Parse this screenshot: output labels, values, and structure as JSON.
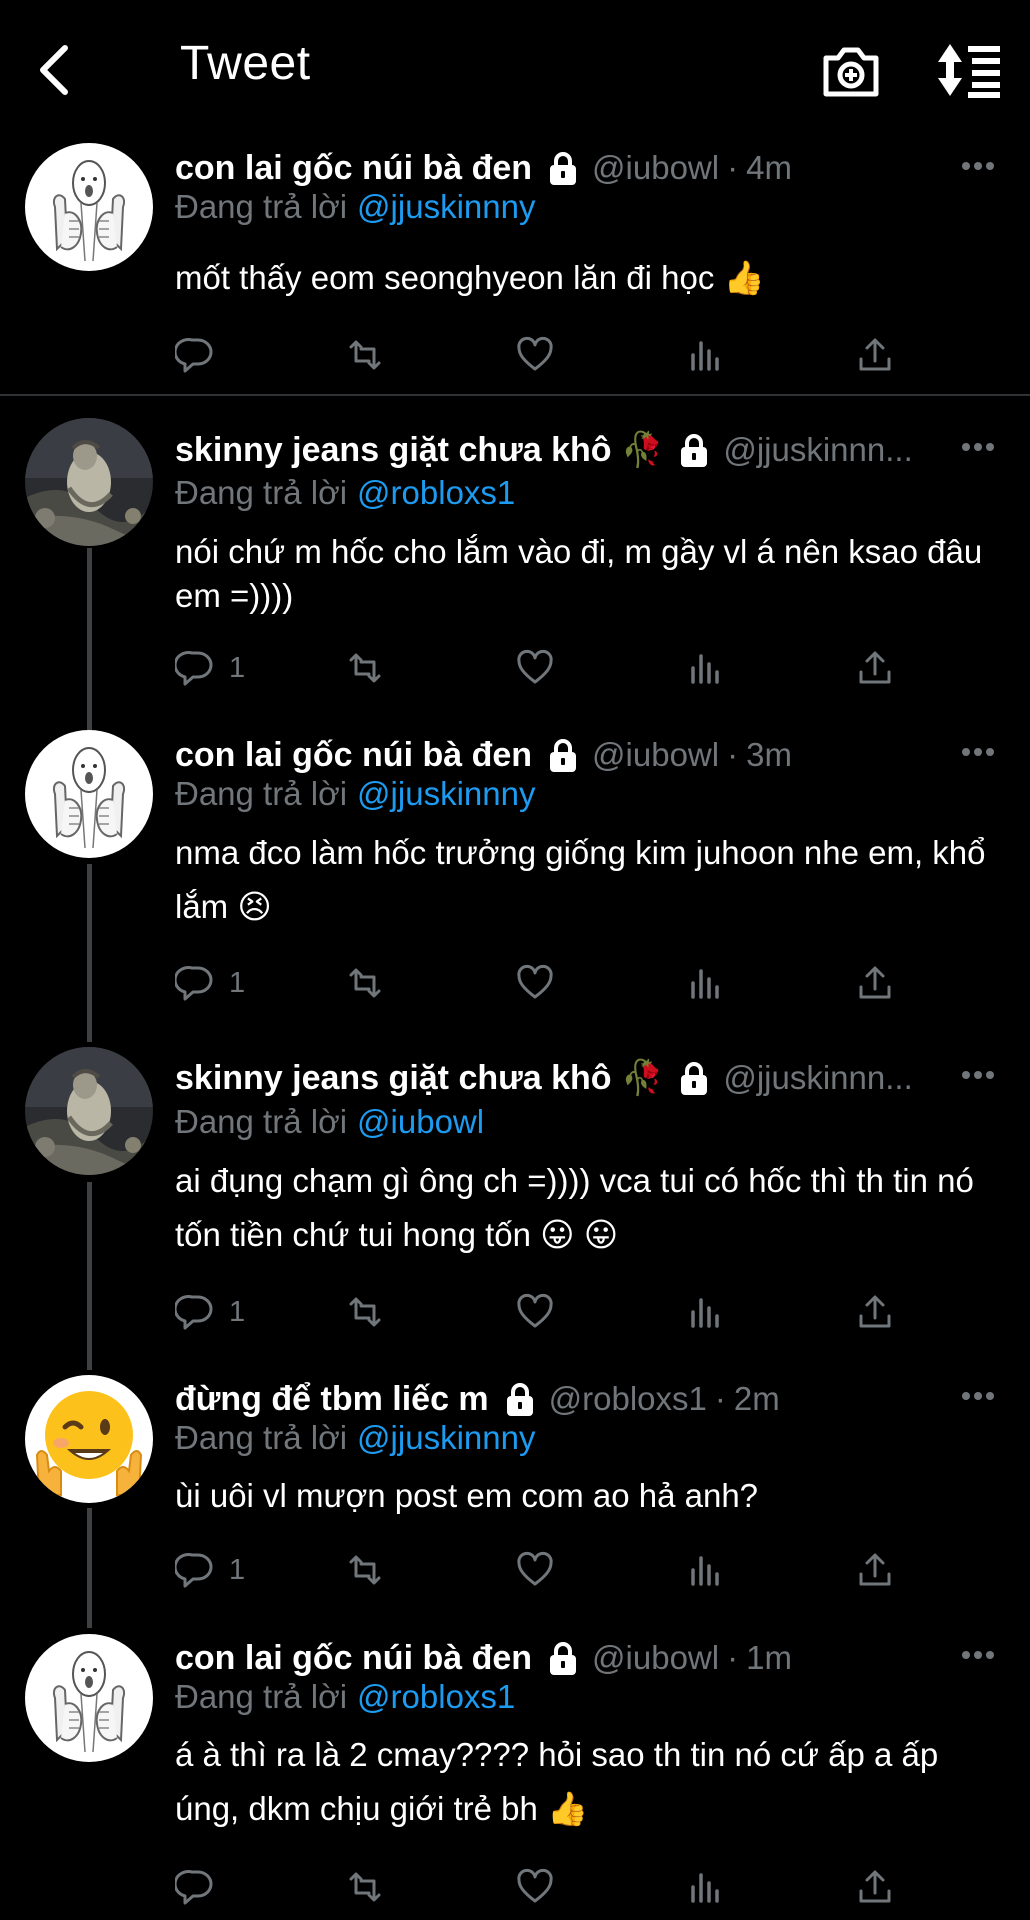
{
  "header": {
    "title": "Tweet",
    "back_icon": "chevron-left-icon",
    "camera_icon": "camera-plus-icon",
    "sort_icon": "sort-icon"
  },
  "reply_prefix": "Đang trả lời",
  "colors": {
    "background": "#000000",
    "text": "#ffffff",
    "muted": "#71767b",
    "mention": "#1d9bf0"
  },
  "tweets": [
    {
      "name": "con lai gốc núi bà đen",
      "handle": "@iubowl",
      "time": "4m",
      "reply_to": "@jjuskinnny",
      "text": "mốt thấy eom seonghyeon lăn đi học 👍",
      "reply_count": ""
    },
    {
      "name": "skinny jeans giặt chưa khô 🥀",
      "handle": "@jjuskinnn...",
      "time": "",
      "reply_to": "@robloxs1",
      "text": "nói chứ m hốc cho lắm vào đi, m gầy vl á nên ksao đâu em =))))",
      "reply_count": "1"
    },
    {
      "name": "con lai gốc núi bà đen",
      "handle": "@iubowl",
      "time": "3m",
      "reply_to": "@jjuskinnny",
      "text": "nma đco làm hốc trưởng giống kim juhoon nhe em, khổ lắm 😣",
      "reply_count": "1"
    },
    {
      "name": "skinny jeans giặt chưa khô 🥀",
      "handle": "@jjuskinnn...",
      "time": "",
      "reply_to": "@iubowl",
      "text": "ai đụng chạm gì ông ch =)))) vca tui có hốc thì th tin nó tốn tiền chứ tui hong tốn 😛 😛",
      "reply_count": "1"
    },
    {
      "name": "đừng để tbm liếc m",
      "handle": "@robloxs1",
      "time": "2m",
      "reply_to": "@jjuskinnny",
      "text": "ùi uôi vl mượn post em com ao hả anh?",
      "reply_count": "1"
    },
    {
      "name": "con lai gốc núi bà đen",
      "handle": "@iubowl",
      "time": "1m",
      "reply_to": "@robloxs1",
      "text": "á à thì ra là 2 cmay???? hỏi sao th tin nó cứ ấp a ấp úng, dkm chịu giới trẻ bh 👍",
      "reply_count": ""
    }
  ]
}
